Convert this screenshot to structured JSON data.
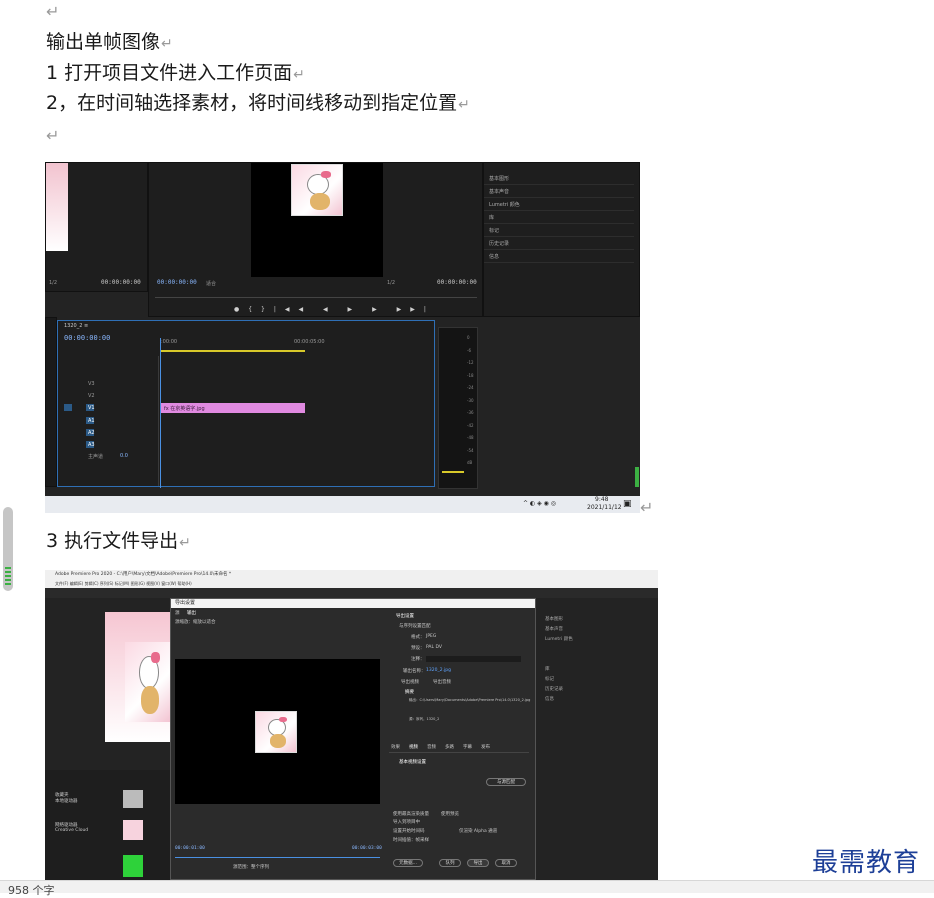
{
  "document": {
    "paragraph_mark": "↵",
    "line_title": "输出单帧图像",
    "line_step1": "1 打开项目文件进入工作页面",
    "line_step2": "2，在时间轴选择素材，将时间线移动到指定位置",
    "line_step3": "3 执行文件导出"
  },
  "screenshot_editor": {
    "timecode_left": "00:00:00:00",
    "timecode_program": "00:00:00:00",
    "timecode_right": "00:00:00:00",
    "sequence_tab": "1320_2 ≡",
    "sequence_timecode": "00:00:00:00",
    "ruler_mark_1": ":00:00",
    "ruler_mark_2": "00:00:05:00",
    "fit_label": "适合",
    "scale_label": "1/2",
    "clip_label": "fx 在京英语字.jpg",
    "tracks": [
      "V3",
      "V2",
      "V1",
      "A1",
      "A2",
      "A3"
    ],
    "master_label": "主声道",
    "master_value": "0.0",
    "right_panel_items": [
      "基本图形",
      "基本声音",
      "Lumetri 颜色",
      "库",
      "标记",
      "历史记录",
      "信息"
    ],
    "meter_labels": [
      "0",
      "-6",
      "-12",
      "-18",
      "-24",
      "-30",
      "-36",
      "-42",
      "-48",
      "-54",
      "dB"
    ],
    "taskbar_time": "9:48",
    "taskbar_date": "2021/11/12"
  },
  "screenshot_export": {
    "window_title": "Adobe Premiere Pro 2020 - C:\\用户\\Mary\\文档\\Adobe\\Premiere Pro\\14.0\\未命名 *",
    "window_menu": "文件(F)  编辑(E)  剪辑(C)  序列(S)  标记(M)  图形(G)  视图(V)  窗口(W)  帮助(H)",
    "dialog_title": "导出设置",
    "dialog_tabs": [
      "源",
      "输出"
    ],
    "source_scaling_label": "源缩放：",
    "source_scaling_value": "缩放以适合",
    "export_settings_heading": "导出设置",
    "match_sequence": "与序列设置匹配",
    "format_label": "格式：",
    "format_value": "JPEG",
    "preset_label": "预设：",
    "preset_value": "PAL DV",
    "comment_label": "注释：",
    "output_name_label": "输出名称：",
    "output_name_value": "1320_2.jpg",
    "export_video": "导出视频",
    "export_audio": "导出音频",
    "summary_heading": "摘要",
    "summary_output": "输出：C:\\Users\\Mary\\Documents\\Adobe\\Premiere Pro\\14.0\\1320_2.jpg",
    "summary_source": "源：序列，1320_2",
    "settings_tabs": [
      "效果",
      "视频",
      "音频",
      "多路",
      "字幕",
      "发布"
    ],
    "basic_video_heading": "基本视频设置",
    "match_source": "与源匹配",
    "bottom_options": [
      "使用最高渲染质量",
      "使用预览",
      "导入到项目中",
      "设置开始时间码",
      "仅渲染 Alpha 通道",
      "时间插值：帧采样"
    ],
    "buttons": {
      "metadata": "元数据...",
      "queue": "队列",
      "export": "导出",
      "cancel": "取消"
    },
    "source_range": "源范围：整个序列",
    "timecode_in": "00:00:01:00",
    "timecode_out": "00:00:03:00",
    "project_panel": [
      "收藏夹",
      "本地驱动器",
      "网络驱动器",
      "Creative Cloud"
    ],
    "right_panel_items": [
      "基本图形",
      "基本声音",
      "Lumetri 颜色",
      "库",
      "标记",
      "历史记录",
      "信息"
    ]
  },
  "status_bar": {
    "word_count": "958 个字"
  },
  "brand": {
    "name": "最需教育"
  },
  "colors": {
    "brand_blue": "#1d3f97",
    "clip_pink": "#e08ae0",
    "timecode_blue": "#8ab8ff"
  }
}
